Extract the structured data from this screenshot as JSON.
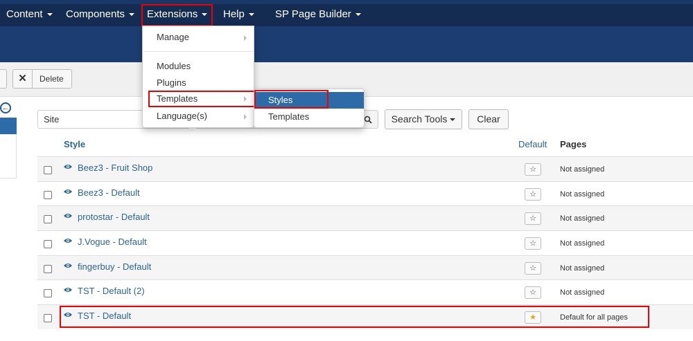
{
  "nav": {
    "items": [
      {
        "label": "Content",
        "has_caret": true
      },
      {
        "label": "Components",
        "has_caret": true
      },
      {
        "label": "Extensions",
        "has_caret": true
      },
      {
        "label": "Help",
        "has_caret": true
      },
      {
        "label": "SP Page Builder",
        "has_caret": true
      }
    ]
  },
  "toolbar": {
    "delete_label": "Delete",
    "delete_icon": "close-icon"
  },
  "extensions_menu": {
    "items": [
      {
        "label": "Manage"
      },
      {
        "label": "Modules"
      },
      {
        "label": "Plugins"
      },
      {
        "label": "Templates"
      },
      {
        "label": "Language(s)"
      }
    ]
  },
  "templates_submenu": {
    "items": [
      {
        "label": "Styles"
      },
      {
        "label": "Templates"
      }
    ]
  },
  "filters": {
    "client_value": "Site",
    "search_tools_label": "Search Tools",
    "clear_label": "Clear"
  },
  "table": {
    "headers": {
      "style": "Style",
      "default": "Default",
      "pages": "Pages"
    },
    "rows": [
      {
        "style": "Beez3 - Fruit Shop",
        "is_default": false,
        "pages": "Not assigned"
      },
      {
        "style": "Beez3 - Default",
        "is_default": false,
        "pages": "Not assigned"
      },
      {
        "style": "protostar - Default",
        "is_default": false,
        "pages": "Not assigned"
      },
      {
        "style": "J.Vogue - Default",
        "is_default": false,
        "pages": "Not assigned"
      },
      {
        "style": "fingerbuy - Default",
        "is_default": false,
        "pages": "Not assigned"
      },
      {
        "style": "TST - Default (2)",
        "is_default": false,
        "pages": "Not assigned"
      },
      {
        "style": "TST - Default",
        "is_default": true,
        "pages": "Default for all pages"
      }
    ]
  },
  "colors": {
    "nav_bg": "#142b52",
    "header_bg": "#1c3d72",
    "link": "#2a6496",
    "highlight": "#e00000",
    "menu_active": "#2d6aa8",
    "star_gold": "#e8a317"
  }
}
